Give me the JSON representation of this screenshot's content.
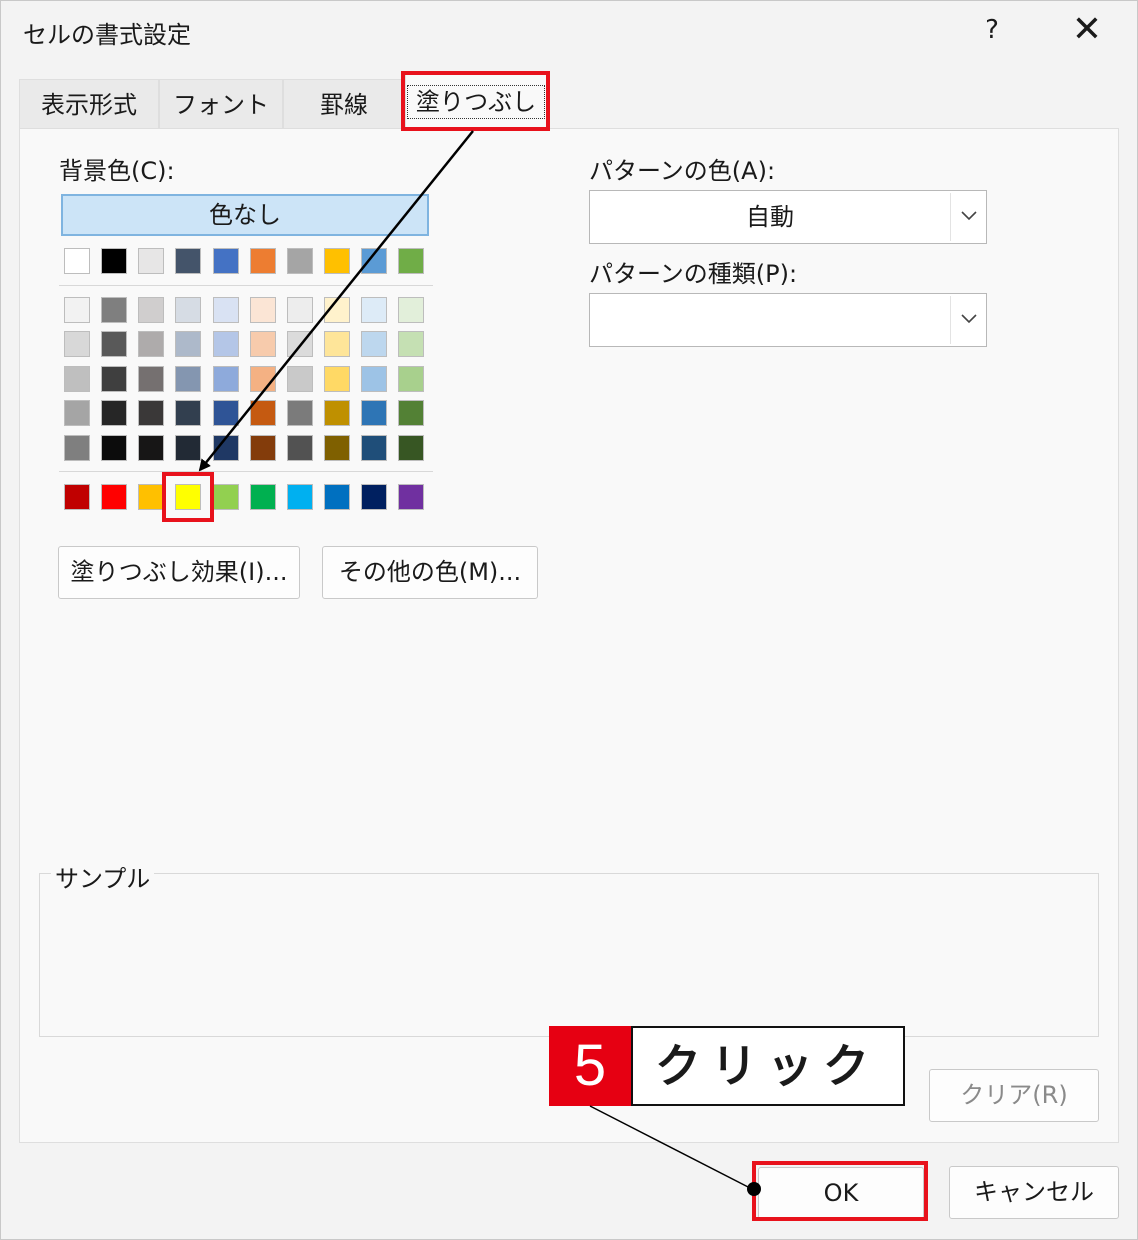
{
  "window": {
    "title": "セルの書式設定",
    "help_label": "?",
    "close_label": "✕"
  },
  "tabs": [
    {
      "label": "表示形式",
      "active": false
    },
    {
      "label": "フォント",
      "active": false
    },
    {
      "label": "罫線",
      "active": false
    },
    {
      "label": "塗りつぶし",
      "active": true
    }
  ],
  "fill": {
    "background_label": "背景色(C):",
    "no_color_label": "色なし",
    "theme_row": [
      "#ffffff",
      "#000000",
      "#e7e6e6",
      "#44546a",
      "#4472c4",
      "#ed7d31",
      "#a5a5a5",
      "#ffc000",
      "#5b9bd5",
      "#70ad47"
    ],
    "tint_rows": [
      [
        "#f2f2f2",
        "#7f7f7f",
        "#d0cece",
        "#d6dce4",
        "#d9e2f3",
        "#fbe5d5",
        "#ededed",
        "#fff2cc",
        "#ddebf7",
        "#e2efda"
      ],
      [
        "#d8d8d8",
        "#595959",
        "#aeabab",
        "#adb9ca",
        "#b4c6e7",
        "#f7cbac",
        "#dbdbdb",
        "#fee599",
        "#bdd7ee",
        "#c5e0b3"
      ],
      [
        "#bfbfbf",
        "#3f3f3f",
        "#757070",
        "#8496b0",
        "#8eaadb",
        "#f4b183",
        "#c9c9c9",
        "#ffd965",
        "#9dc3e6",
        "#a8d08d"
      ],
      [
        "#a5a5a5",
        "#262626",
        "#3a3838",
        "#323f4f",
        "#2f5496",
        "#c55a11",
        "#7b7b7b",
        "#bf9000",
        "#2e75b5",
        "#538135"
      ],
      [
        "#7f7f7f",
        "#0c0c0c",
        "#171616",
        "#222a35",
        "#1f3864",
        "#833c0b",
        "#525252",
        "#7f6000",
        "#1f4e79",
        "#375623"
      ]
    ],
    "standard_row": [
      "#c00000",
      "#ff0000",
      "#ffc000",
      "#ffff00",
      "#92d050",
      "#00b050",
      "#00b0f0",
      "#0070c0",
      "#002060",
      "#7030a0"
    ],
    "selected_standard_index": 3,
    "fill_effects_label": "塗りつぶし効果(I)...",
    "more_colors_label": "その他の色(M)...",
    "pattern_color_label": "パターンの色(A):",
    "pattern_color_value": "自動",
    "pattern_style_label": "パターンの種類(P):",
    "pattern_style_value": "",
    "sample_label": "サンプル",
    "clear_label": "クリア(R)"
  },
  "footer": {
    "ok_label": "OK",
    "cancel_label": "キャンセル"
  },
  "annotation": {
    "step_number": "5",
    "step_text": "クリック",
    "highlight_color": "#e8121c"
  }
}
